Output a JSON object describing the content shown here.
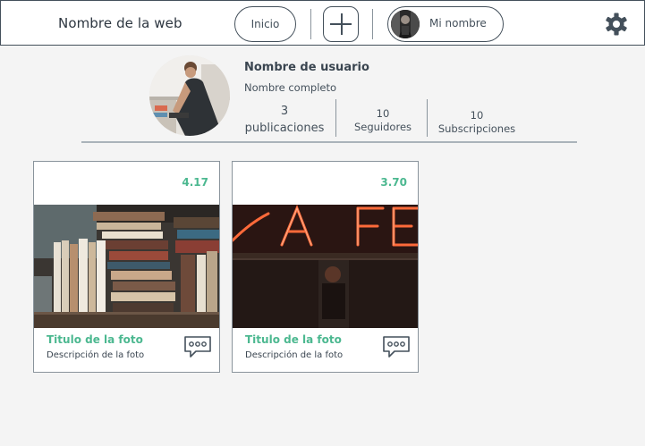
{
  "header": {
    "site_title": "Nombre de la web",
    "nav_inicio": "Inicio",
    "user_name": "Mi nombre"
  },
  "profile": {
    "username": "Nombre de usuario",
    "full_name": "Nombre completo",
    "stats": [
      {
        "value": "3",
        "label": "publicaciones"
      },
      {
        "value": "10",
        "label": "Seguidores"
      },
      {
        "value": "10",
        "label": "Subscripciones"
      }
    ]
  },
  "posts": [
    {
      "rating": "4.17",
      "title": "Titulo de la foto",
      "description": "Descripción de la foto",
      "image": "bookshelf-photo"
    },
    {
      "rating": "3.70",
      "title": "Titulo de la foto",
      "description": "Descripción de la foto",
      "image": "neon-cafe-photo"
    }
  ],
  "colors": {
    "accent": "#4cb890",
    "border": "#44505b",
    "background": "#f4f4f4"
  }
}
